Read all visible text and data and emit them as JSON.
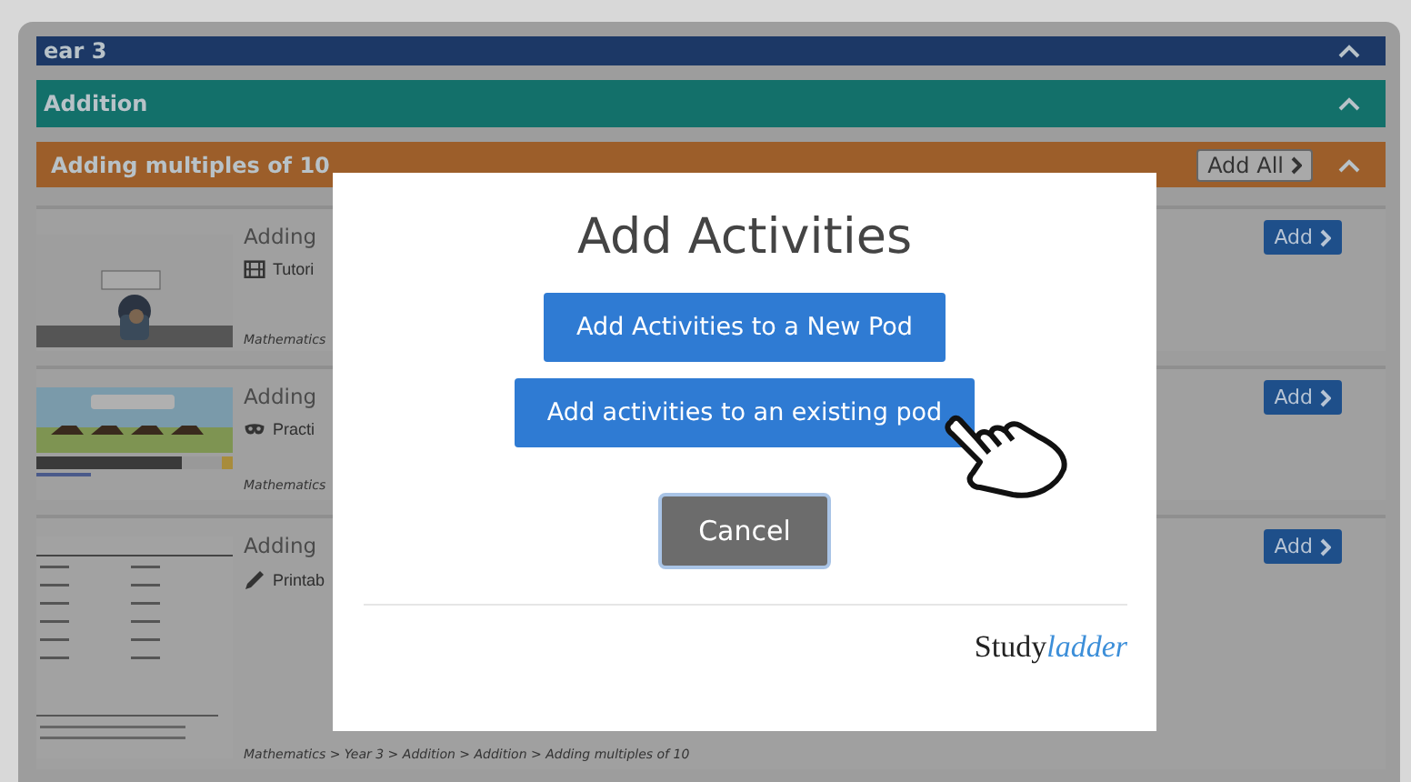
{
  "sections": [
    {
      "title": "ear 3",
      "kind": "year",
      "expanded": true
    },
    {
      "title": "Addition",
      "kind": "strand",
      "expanded": true
    },
    {
      "title": "Adding multiples of 10",
      "kind": "topic",
      "expanded": true,
      "add_all": "Add All"
    }
  ],
  "activities": [
    {
      "title": "Adding",
      "kind": "tutorial",
      "type": "Tutori",
      "breadcrumb": "Mathematics",
      "button": "Add"
    },
    {
      "title": "Adding",
      "kind": "practice",
      "type": "Practi",
      "breadcrumb": "Mathematics",
      "button": "Add"
    },
    {
      "title": "Adding",
      "kind": "printable",
      "type": "Printab",
      "breadcrumb": "Mathematics > Year 3 > Addition > Addition > Adding multiples of 10",
      "button": "Add"
    }
  ],
  "modal": {
    "title": "Add Activities",
    "options": [
      "Add Activities to a New Pod",
      "Add activities to an existing pod"
    ],
    "cancel": "Cancel",
    "brand": {
      "plain": "Study",
      "italic": "ladder"
    }
  }
}
